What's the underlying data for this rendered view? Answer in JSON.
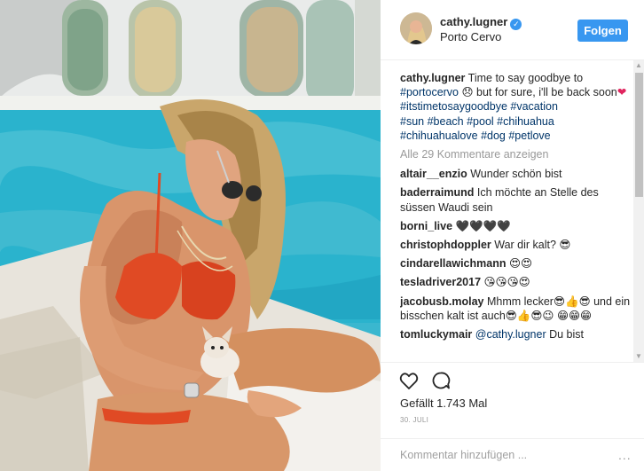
{
  "post": {
    "username": "cathy.lugner",
    "verified_badge": "verified-check-icon",
    "location": "Porto Cervo",
    "follow_label": "Folgen"
  },
  "caption": {
    "username": "cathy.lugner",
    "text_1": "Time to say goodbye to",
    "tag_portocervo": "#portocervo",
    "emoji_1": "😞",
    "text_2": "but for sure, i'll be back soon",
    "emoji_heart": "❤",
    "tag_itstimetosaygoodbye": "#itstimetosaygoodbye",
    "tag_vacation": "#vacation",
    "tag_sun": "#sun",
    "tag_beach": "#beach",
    "tag_pool": "#pool",
    "tag_chihuahua": "#chihuahua",
    "tag_chihuahualove": "#chihuahualove",
    "tag_dog": "#dog",
    "tag_petlove": "#petlove"
  },
  "load_more": "Alle 29 Kommentare anzeigen",
  "comments": [
    {
      "user": "altair__enzio",
      "text": "Wunder schön bist"
    },
    {
      "user": "baderraimund",
      "text": "Ich möchte an Stelle des süssen Waudi sein"
    },
    {
      "user": "borni_live",
      "text": "🖤🖤🖤🖤"
    },
    {
      "user": "christophdoppler",
      "text": "War dir kalt? 😎"
    },
    {
      "user": "cindarellawichmann",
      "text": "😍😍"
    },
    {
      "user": "teslادriver2017",
      "text": "😘😘😘😍"
    },
    {
      "user": "jacobusb.molay",
      "text": "Mhmm lecker😎👍😎 und ein bisschen kalt ist auch😎👍😎😉 😁😁😁"
    },
    {
      "user": "tomluckymair",
      "mention": "@cathy.lugner",
      "text": "Du bist"
    }
  ],
  "actions": {
    "like_icon": "heart-outline-icon",
    "comment_icon": "speech-bubble-icon",
    "likes_text": "Gefällt 1.743 Mal",
    "date": "30. JULI"
  },
  "comment_input": {
    "placeholder": "Kommentar hinzufügen ...",
    "options": "..."
  },
  "colors": {
    "accent": "#3897f0",
    "hashtag": "#003569",
    "muted": "#999999"
  }
}
